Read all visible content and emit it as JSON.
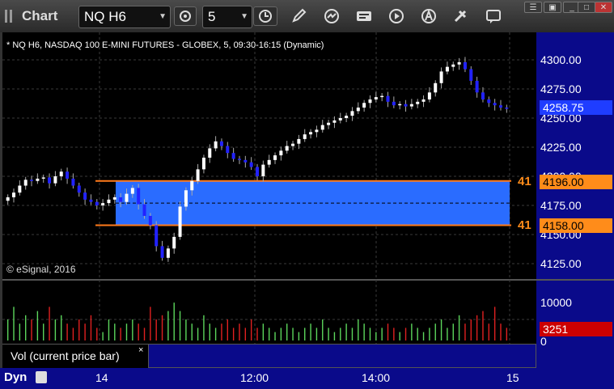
{
  "window": {
    "title": "Chart"
  },
  "toolbar": {
    "symbol": "NQ H6",
    "interval": "5"
  },
  "chart": {
    "header": "* NQ H6, NASDAQ 100 E-MINI FUTURES - GLOBEX, 5, 09:30-16:15 (Dynamic)",
    "copyright": "© eSignal, 2016",
    "price_ticks": [
      "4300.00",
      "4275.00",
      "4250.00",
      "4225.00",
      "4200.00",
      "4175.00",
      "4150.00",
      "4125.00"
    ],
    "last_price": "4258.75",
    "upper_level": {
      "marker": "41",
      "price": "4196.00"
    },
    "lower_level": {
      "marker": "41",
      "price": "4158.00"
    },
    "time_ticks": [
      "14",
      "12:00",
      "14:00",
      "15"
    ]
  },
  "volume": {
    "ticks": [
      "10000",
      "0"
    ],
    "current": "3251",
    "legend": "Vol (current price bar)",
    "legend_close": "×"
  },
  "footer": {
    "mode": "Dyn"
  },
  "colors": {
    "up": "#ffffff",
    "down": "#2222ff",
    "band": "#2a6cff",
    "level_line": "#ff7a1a",
    "axis_bg": "#0a0a8a",
    "vol_up": "#5cd65c",
    "vol_down": "#e02020"
  },
  "chart_data": {
    "type": "candlestick",
    "ylim": [
      4115,
      4310
    ],
    "bands": [
      {
        "from": 4158,
        "to": 4196
      }
    ],
    "series": [
      {
        "close": [
          4182,
          4186,
          4192,
          4197,
          4196,
          4198,
          4199,
          4194,
          4200,
          4204,
          4198,
          4192,
          4186,
          4180,
          4178,
          4175,
          4177,
          4180,
          4182,
          4178,
          4185,
          4190,
          4176,
          4166,
          4158,
          4140,
          4130,
          4138,
          4148,
          4174,
          4188,
          4196,
          4206,
          4216,
          4224,
          4230,
          4226,
          4220,
          4215,
          4214,
          4212,
          4208,
          4200,
          4210,
          4214,
          4218,
          4222,
          4226,
          4228,
          4232,
          4236,
          4238,
          4240,
          4244,
          4246,
          4248,
          4250,
          4252,
          4256,
          4259,
          4263,
          4266,
          4268,
          4269,
          4264,
          4261,
          4262,
          4260,
          4262,
          4264,
          4266,
          4272,
          4280,
          4290,
          4294,
          4296,
          4298,
          4292,
          4282,
          4272,
          4266,
          4263,
          4261,
          4259,
          4258
        ],
        "vol": [
          0.5,
          0.8,
          0.4,
          0.6,
          0.5,
          0.7,
          0.4,
          0.8,
          0.5,
          0.6,
          0.4,
          0.3,
          0.5,
          0.4,
          0.6,
          0.3,
          0.2,
          0.5,
          0.4,
          0.3,
          0.4,
          0.5,
          0.4,
          0.3,
          0.8,
          0.5,
          0.6,
          0.7,
          0.9,
          0.7,
          0.5,
          0.4,
          0.3,
          0.6,
          0.4,
          0.3,
          0.4,
          0.5,
          0.3,
          0.4,
          0.3,
          0.5,
          0.3,
          0.4,
          0.3,
          0.2,
          0.3,
          0.4,
          0.3,
          0.2,
          0.3,
          0.4,
          0.3,
          0.5,
          0.3,
          0.2,
          0.3,
          0.4,
          0.3,
          0.5,
          0.4,
          0.3,
          0.2,
          0.3,
          0.4,
          0.3,
          0.2,
          0.3,
          0.4,
          0.3,
          0.2,
          0.3,
          0.4,
          0.5,
          0.3,
          0.4,
          0.6,
          0.4,
          0.5,
          0.6,
          0.7,
          0.4,
          0.8,
          0.4,
          0.3
        ]
      }
    ]
  }
}
